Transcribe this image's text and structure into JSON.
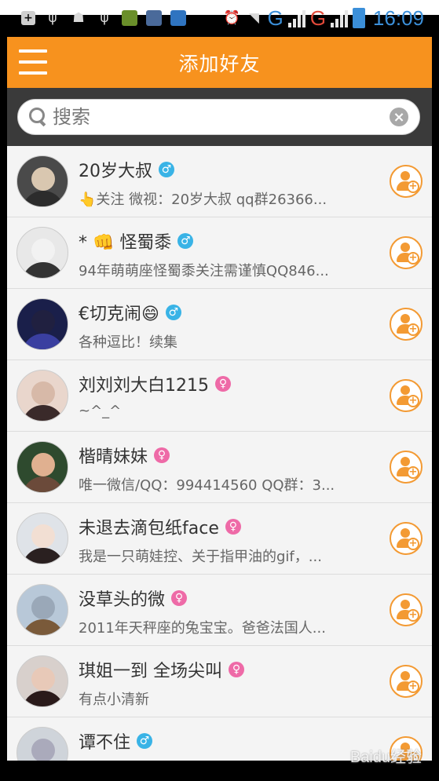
{
  "status_bar": {
    "network_1": "G",
    "network_2": "G",
    "time": "16:09"
  },
  "header": {
    "title": "添加好友"
  },
  "search": {
    "placeholder": "搜索"
  },
  "friends": [
    {
      "name": "20岁大叔",
      "gender": "male",
      "desc": "👆关注 微视：20岁大叔 qq群26366..."
    },
    {
      "name": "* 👊 怪蜀黍",
      "gender": "male",
      "desc": "94年萌萌座怪蜀黍关注需谨慎QQ846..."
    },
    {
      "name": "€切克闹😄",
      "gender": "male",
      "desc": "各种逗比！续集"
    },
    {
      "name": "刘刘刘大白1215",
      "gender": "female",
      "desc": "~^_^"
    },
    {
      "name": "楷晴妹妹",
      "gender": "female",
      "desc": "唯一微信/QQ：994414560 QQ群：3..."
    },
    {
      "name": "未退去滴包纸face",
      "gender": "female",
      "desc": "我是一只萌娃控、关于指甲油的gif，..."
    },
    {
      "name": "没草头的微",
      "gender": "female",
      "desc": "2011年天秤座的兔宝宝。爸爸法国人..."
    },
    {
      "name": "琪姐一到 全场尖叫",
      "gender": "female",
      "desc": "有点小清新"
    },
    {
      "name": "谭不住",
      "gender": "male",
      "desc": ""
    }
  ],
  "gender_symbols": {
    "male": "♂",
    "female": "♀"
  },
  "colors": {
    "accent": "#f7921e",
    "male": "#39b3e6",
    "female": "#ee6aa7"
  },
  "watermark": "Baidu经验"
}
